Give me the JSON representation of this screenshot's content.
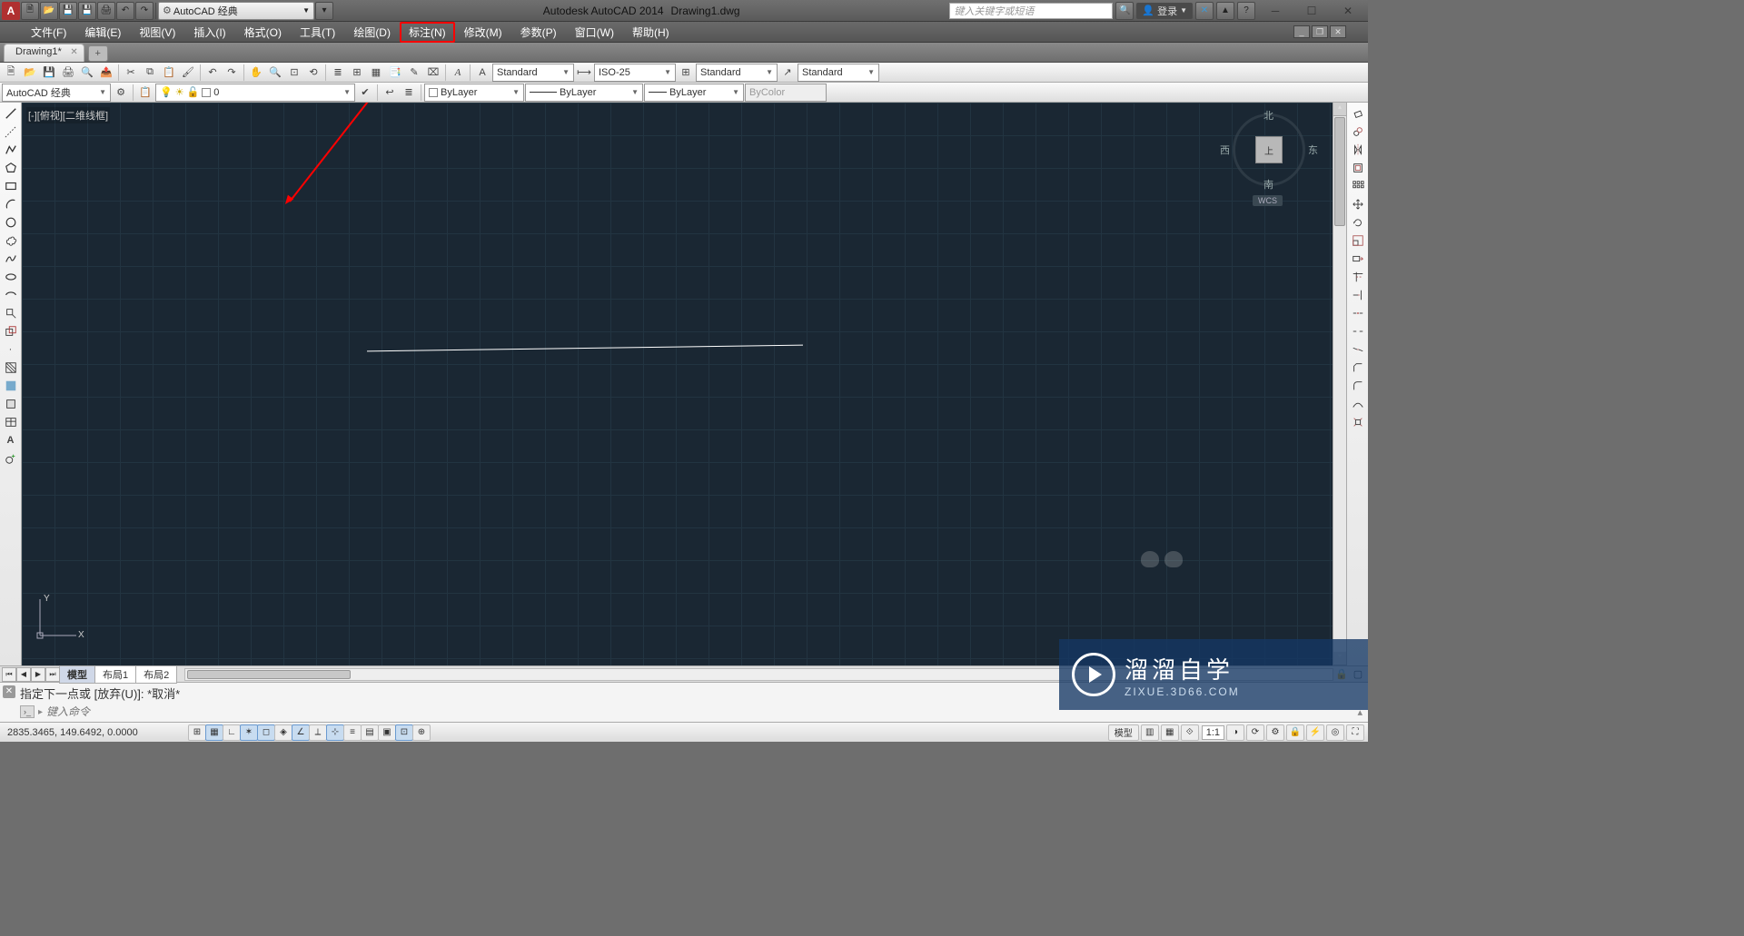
{
  "title": {
    "app": "Autodesk AutoCAD 2014",
    "file": "Drawing1.dwg"
  },
  "qat": {
    "workspace": "AutoCAD 经典"
  },
  "search": {
    "placeholder": "键入关键字或短语"
  },
  "signin": {
    "label": "登录"
  },
  "menus": [
    "文件(F)",
    "编辑(E)",
    "视图(V)",
    "插入(I)",
    "格式(O)",
    "工具(T)",
    "绘图(D)",
    "标注(N)",
    "修改(M)",
    "参数(P)",
    "窗口(W)",
    "帮助(H)"
  ],
  "highlighted_menu_index": 7,
  "doc_tab": {
    "name": "Drawing1*"
  },
  "toolbar2": {
    "workspace_dd": "AutoCAD 经典",
    "layer_dd": "0",
    "text_style": "Standard",
    "dim_style": "ISO-25",
    "table_style": "Standard",
    "mleader_style": "Standard",
    "layer_color": "ByLayer",
    "lineweight": "ByLayer",
    "linetype": "ByLayer",
    "plot_style": "ByColor"
  },
  "viewport_label": "[-][俯视][二维线框]",
  "viewcube": {
    "n": "北",
    "s": "南",
    "e": "东",
    "w": "西",
    "top": "上",
    "wcs": "WCS"
  },
  "layout_tabs": {
    "model": "模型",
    "l1": "布局1",
    "l2": "布局2"
  },
  "cmd": {
    "history": "指定下一点或 [放弃(U)]: *取消*",
    "placeholder": "键入命令"
  },
  "status": {
    "coords": "2835.3465, 149.6492, 0.0000",
    "model_btn": "模型",
    "scale": "1:1"
  },
  "watermark": {
    "big": "溜溜自学",
    "small": "ZIXUE.3D66.COM"
  }
}
